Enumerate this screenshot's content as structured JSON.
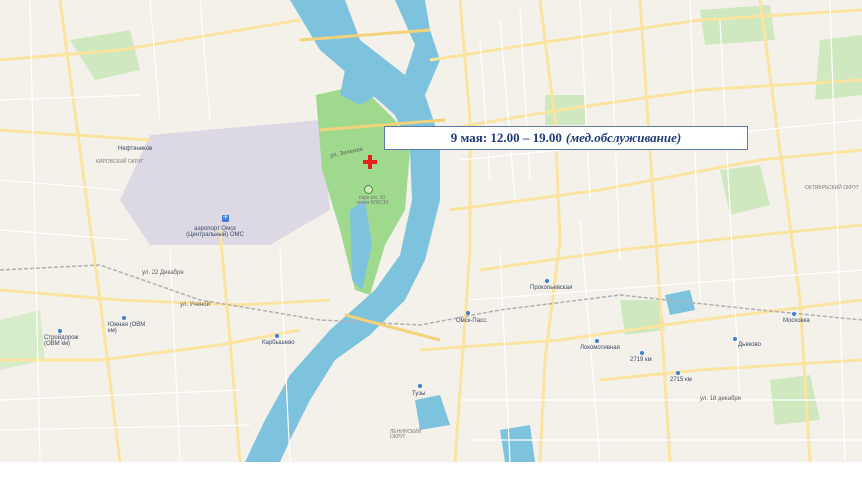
{
  "banner": {
    "date_time": "9 мая: 12.00 – 19.00",
    "note": "(мед.обслуживание)"
  },
  "map": {
    "colors": {
      "land": "#f4f1ea",
      "water": "#7ec3dd",
      "park": "#9fd98d",
      "airfield": "#ddd9e4",
      "roads": "#fbe3a0",
      "marker": "#e8201c",
      "banner_text": "#1f3a78"
    },
    "labels": {
      "neftyannik": "Нефтяников",
      "kirovsky": "КИРОВСКИЙ ОКРУГ",
      "airport": "аэропорт Омск (Центральный) ОМС",
      "park_name": "парк им. 30 летия ВЛКСМ",
      "oktyabrsky": "ОКТЯБРЬСКИЙ ОКРУГ",
      "omsk_pass": "Омск-Пасс.",
      "prokopievskaya": "Прокопьевская",
      "loskomotivnaya": "Локомотивная",
      "km2719": "2719 км",
      "km2715": "2715 км",
      "dyakovo": "Дьяково",
      "moskovka": "Московка",
      "yuzhnaya_ovm": "Южная (ОВМ км)",
      "karbyshevo": "Карбышево",
      "stroitelnoe": "Стройдорож (ОВМ км)",
      "tuzovo": "Тузы",
      "ul_22_dekabrya": "ул. 22 Декабря",
      "ul_uchenoy": "ул. Ученой",
      "ul_18_dekabrya": "ул. 18 декабря",
      "leninsky": "ЛЕНИНСКИЙ ОКРУГ",
      "zelenaya": "ул. Зеленая"
    }
  }
}
